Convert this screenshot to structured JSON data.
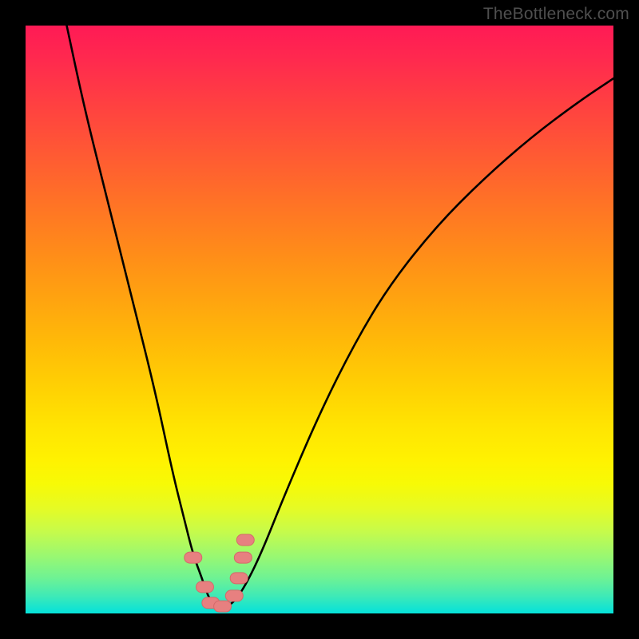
{
  "watermark": "TheBottleneck.com",
  "chart_data": {
    "type": "line",
    "title": "",
    "xlabel": "",
    "ylabel": "",
    "xlim": [
      0,
      100
    ],
    "ylim": [
      0,
      100
    ],
    "grid": false,
    "series": [
      {
        "name": "curve",
        "x": [
          7,
          10,
          14,
          18,
          22,
          25,
          27,
          28.5,
          30,
          31,
          32,
          33.5,
          35,
          37,
          40,
          44,
          50,
          56,
          62,
          70,
          78,
          86,
          94,
          100
        ],
        "y": [
          100,
          86,
          70,
          54,
          38,
          24,
          16,
          10,
          6,
          3,
          1.5,
          1,
          1.5,
          4,
          10,
          20,
          34,
          46,
          56,
          66,
          74,
          81,
          87,
          91
        ]
      }
    ],
    "markers": [
      {
        "name": "points",
        "shape": "capsule",
        "color": "#e78080",
        "stroke": "#d46a6a",
        "x": [
          28.5,
          30.5,
          31.5,
          33.5,
          35.5,
          36.3,
          37.0,
          37.4
        ],
        "y": [
          9.5,
          4.5,
          1.8,
          1.2,
          3.0,
          6.0,
          9.5,
          12.5
        ]
      }
    ],
    "gradient_stops": [
      {
        "pos": 0.0,
        "color": "#ff1a55"
      },
      {
        "pos": 0.5,
        "color": "#ffc208"
      },
      {
        "pos": 0.75,
        "color": "#fdf402"
      },
      {
        "pos": 1.0,
        "color": "#06e2da"
      }
    ]
  }
}
